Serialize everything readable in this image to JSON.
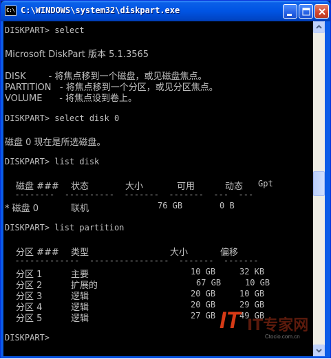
{
  "window": {
    "title": "C:\\WINDOWS\\system32\\diskpart.exe",
    "icon_text": "C:\\"
  },
  "console": {
    "lines": [
      "DISKPART> select",
      "",
      "Microsoft DiskPart 版本 5.1.3565",
      "",
      "DISK        - 将焦点移到一个磁盘，或见磁盘焦点。",
      "PARTITION   - 将焦点移到一个分区，或见分区焦点。",
      "VOLUME      - 将焦点设到卷上。",
      "",
      "DISKPART> select disk 0",
      "",
      "磁盘 0 现在是所选磁盘。",
      "",
      "DISKPART> list disk",
      "",
      "DISKPART> list partition",
      "",
      "DISKPART>"
    ],
    "disk_table": {
      "headers": [
        "磁盘 ###",
        "状态",
        "大小",
        "可用",
        "动态",
        "Gpt"
      ],
      "separator": "  --------  ----------  -------  -------  ---  ---",
      "rows": [
        [
          "* 磁盘 0",
          "联机",
          "76 GB",
          "0 B",
          "",
          ""
        ]
      ]
    },
    "partition_table": {
      "headers": [
        "分区 ###",
        "类型",
        "大小",
        "偏移"
      ],
      "separator": "  -------------  ----------------  -------  -------",
      "rows": [
        [
          "分区 1",
          "主要",
          "10 GB",
          "32 KB"
        ],
        [
          "分区 2",
          "扩展的",
          "67 GB",
          "10 GB"
        ],
        [
          "分区 3",
          "逻辑",
          "20 GB",
          "10 GB"
        ],
        [
          "分区 4",
          "逻辑",
          "20 GB",
          "29 GB"
        ],
        [
          "分区 5",
          "逻辑",
          "27 GB",
          "49 GB"
        ]
      ]
    }
  },
  "watermark": {
    "logo": "IT专家网",
    "url": "Ctocio.com.cn"
  },
  "colors": {
    "console_bg": "#000000",
    "console_fg": "#c0c0c0",
    "titlebar": "#0054e3"
  },
  "icons": [
    "console-app-icon",
    "minimize-icon",
    "maximize-icon",
    "close-icon",
    "scroll-up-icon",
    "scroll-down-icon"
  ]
}
